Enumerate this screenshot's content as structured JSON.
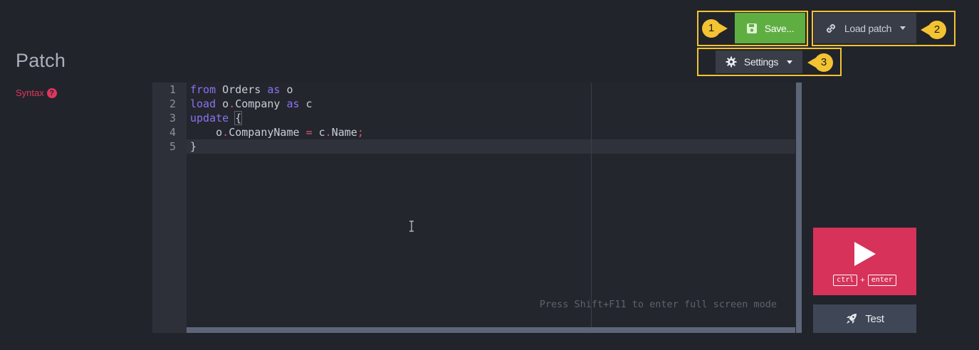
{
  "page": {
    "title": "Patch",
    "syntax_label": "Syntax",
    "help_glyph": "?"
  },
  "toolbar": {
    "save_label": "Save...",
    "load_label": "Load patch",
    "settings_label": "Settings"
  },
  "callouts": [
    "1",
    "2",
    "3"
  ],
  "editor": {
    "line_numbers": [
      "1",
      "2",
      "3",
      "4",
      "5"
    ],
    "lines": [
      [
        {
          "t": "from",
          "c": "kw"
        },
        {
          "t": " Orders ",
          "c": ""
        },
        {
          "t": "as",
          "c": "kw"
        },
        {
          "t": " o",
          "c": ""
        }
      ],
      [
        {
          "t": "load",
          "c": "kw"
        },
        {
          "t": " o",
          "c": ""
        },
        {
          "t": ".",
          "c": "op"
        },
        {
          "t": "Company ",
          "c": ""
        },
        {
          "t": "as",
          "c": "kw"
        },
        {
          "t": " c",
          "c": ""
        }
      ],
      [
        {
          "t": "update",
          "c": "kw"
        },
        {
          "t": " ",
          "c": ""
        },
        {
          "t": "{",
          "c": "brace-box"
        }
      ],
      [
        {
          "t": "    o",
          "c": ""
        },
        {
          "t": ".",
          "c": "op"
        },
        {
          "t": "CompanyName ",
          "c": ""
        },
        {
          "t": "=",
          "c": "op"
        },
        {
          "t": " c",
          "c": ""
        },
        {
          "t": ".",
          "c": "op"
        },
        {
          "t": "Name",
          "c": ""
        },
        {
          "t": ";",
          "c": "op"
        }
      ],
      [
        {
          "t": "}",
          "c": ""
        }
      ]
    ],
    "hint": "Press Shift+F11 to enter full screen mode"
  },
  "run": {
    "key1": "ctrl",
    "plus": "+",
    "key2": "enter"
  },
  "test": {
    "label": "Test"
  },
  "colors": {
    "accent_red": "#d6325a",
    "save_green": "#5fae42",
    "highlight_yellow": "#f3c332",
    "keyword": "#8a73f0"
  }
}
